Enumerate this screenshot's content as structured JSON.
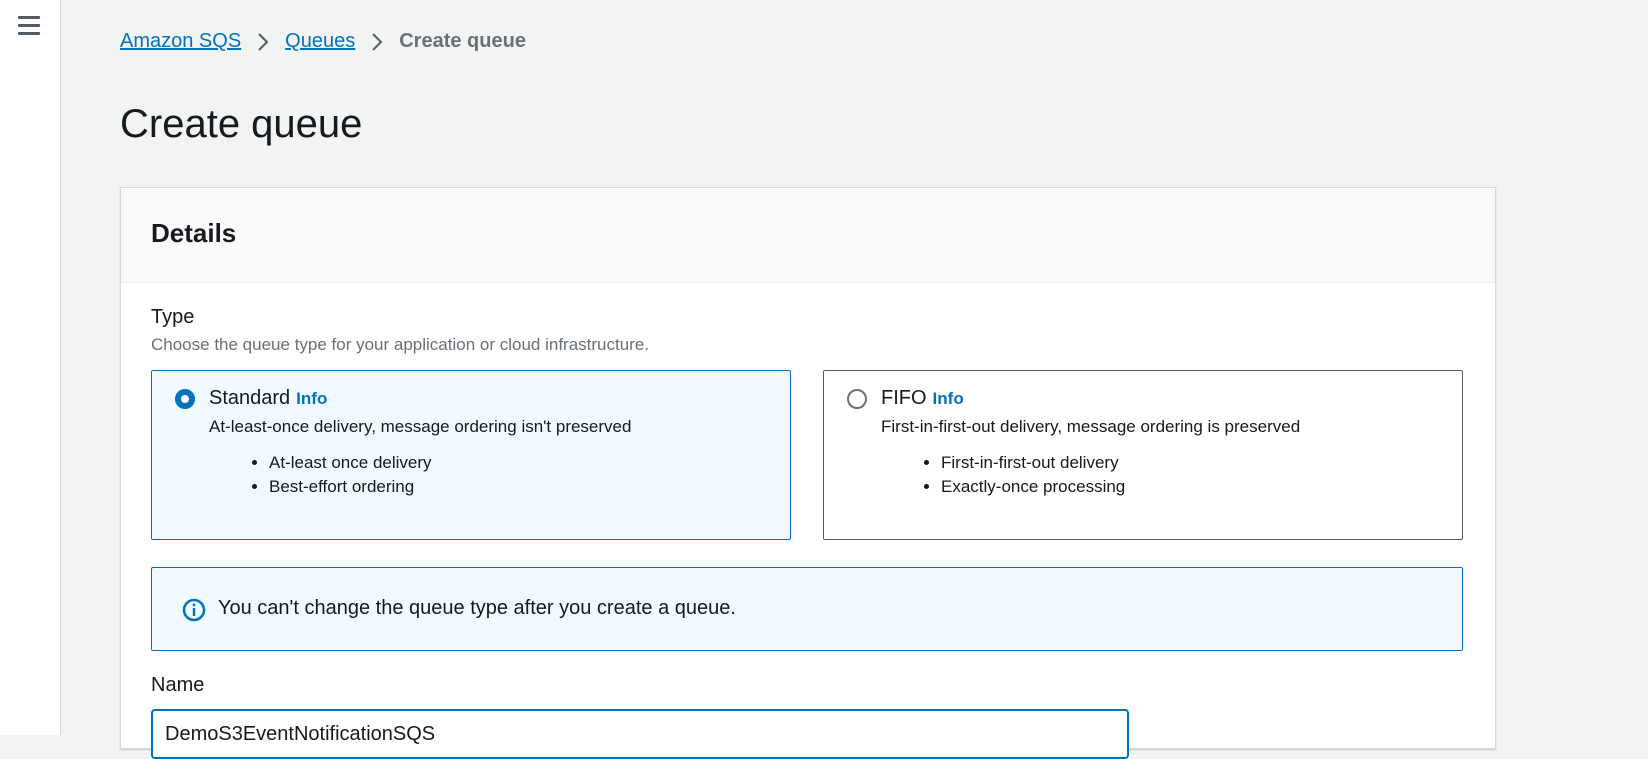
{
  "breadcrumb": {
    "items": [
      "Amazon SQS",
      "Queues"
    ],
    "current": "Create queue"
  },
  "page": {
    "title": "Create queue"
  },
  "details": {
    "title": "Details",
    "type": {
      "label": "Type",
      "description": "Choose the queue type for your application or cloud infrastructure.",
      "selected": "Standard",
      "options": [
        {
          "title": "Standard",
          "info": "Info",
          "description": "At-least-once delivery, message ordering isn't preserved",
          "bullets": [
            "At-least once delivery",
            "Best-effort ordering"
          ]
        },
        {
          "title": "FIFO",
          "info": "Info",
          "description": "First-in-first-out delivery, message ordering is preserved",
          "bullets": [
            "First-in-first-out delivery",
            "Exactly-once processing"
          ]
        }
      ]
    },
    "alert": {
      "text": "You can't change the queue type after you create a queue."
    },
    "name": {
      "label": "Name",
      "value": "DemoS3EventNotificationSQS"
    }
  },
  "colors": {
    "accent": "#0073bb",
    "background": "#f2f3f3",
    "text": "#16191f",
    "muted": "#687078"
  }
}
